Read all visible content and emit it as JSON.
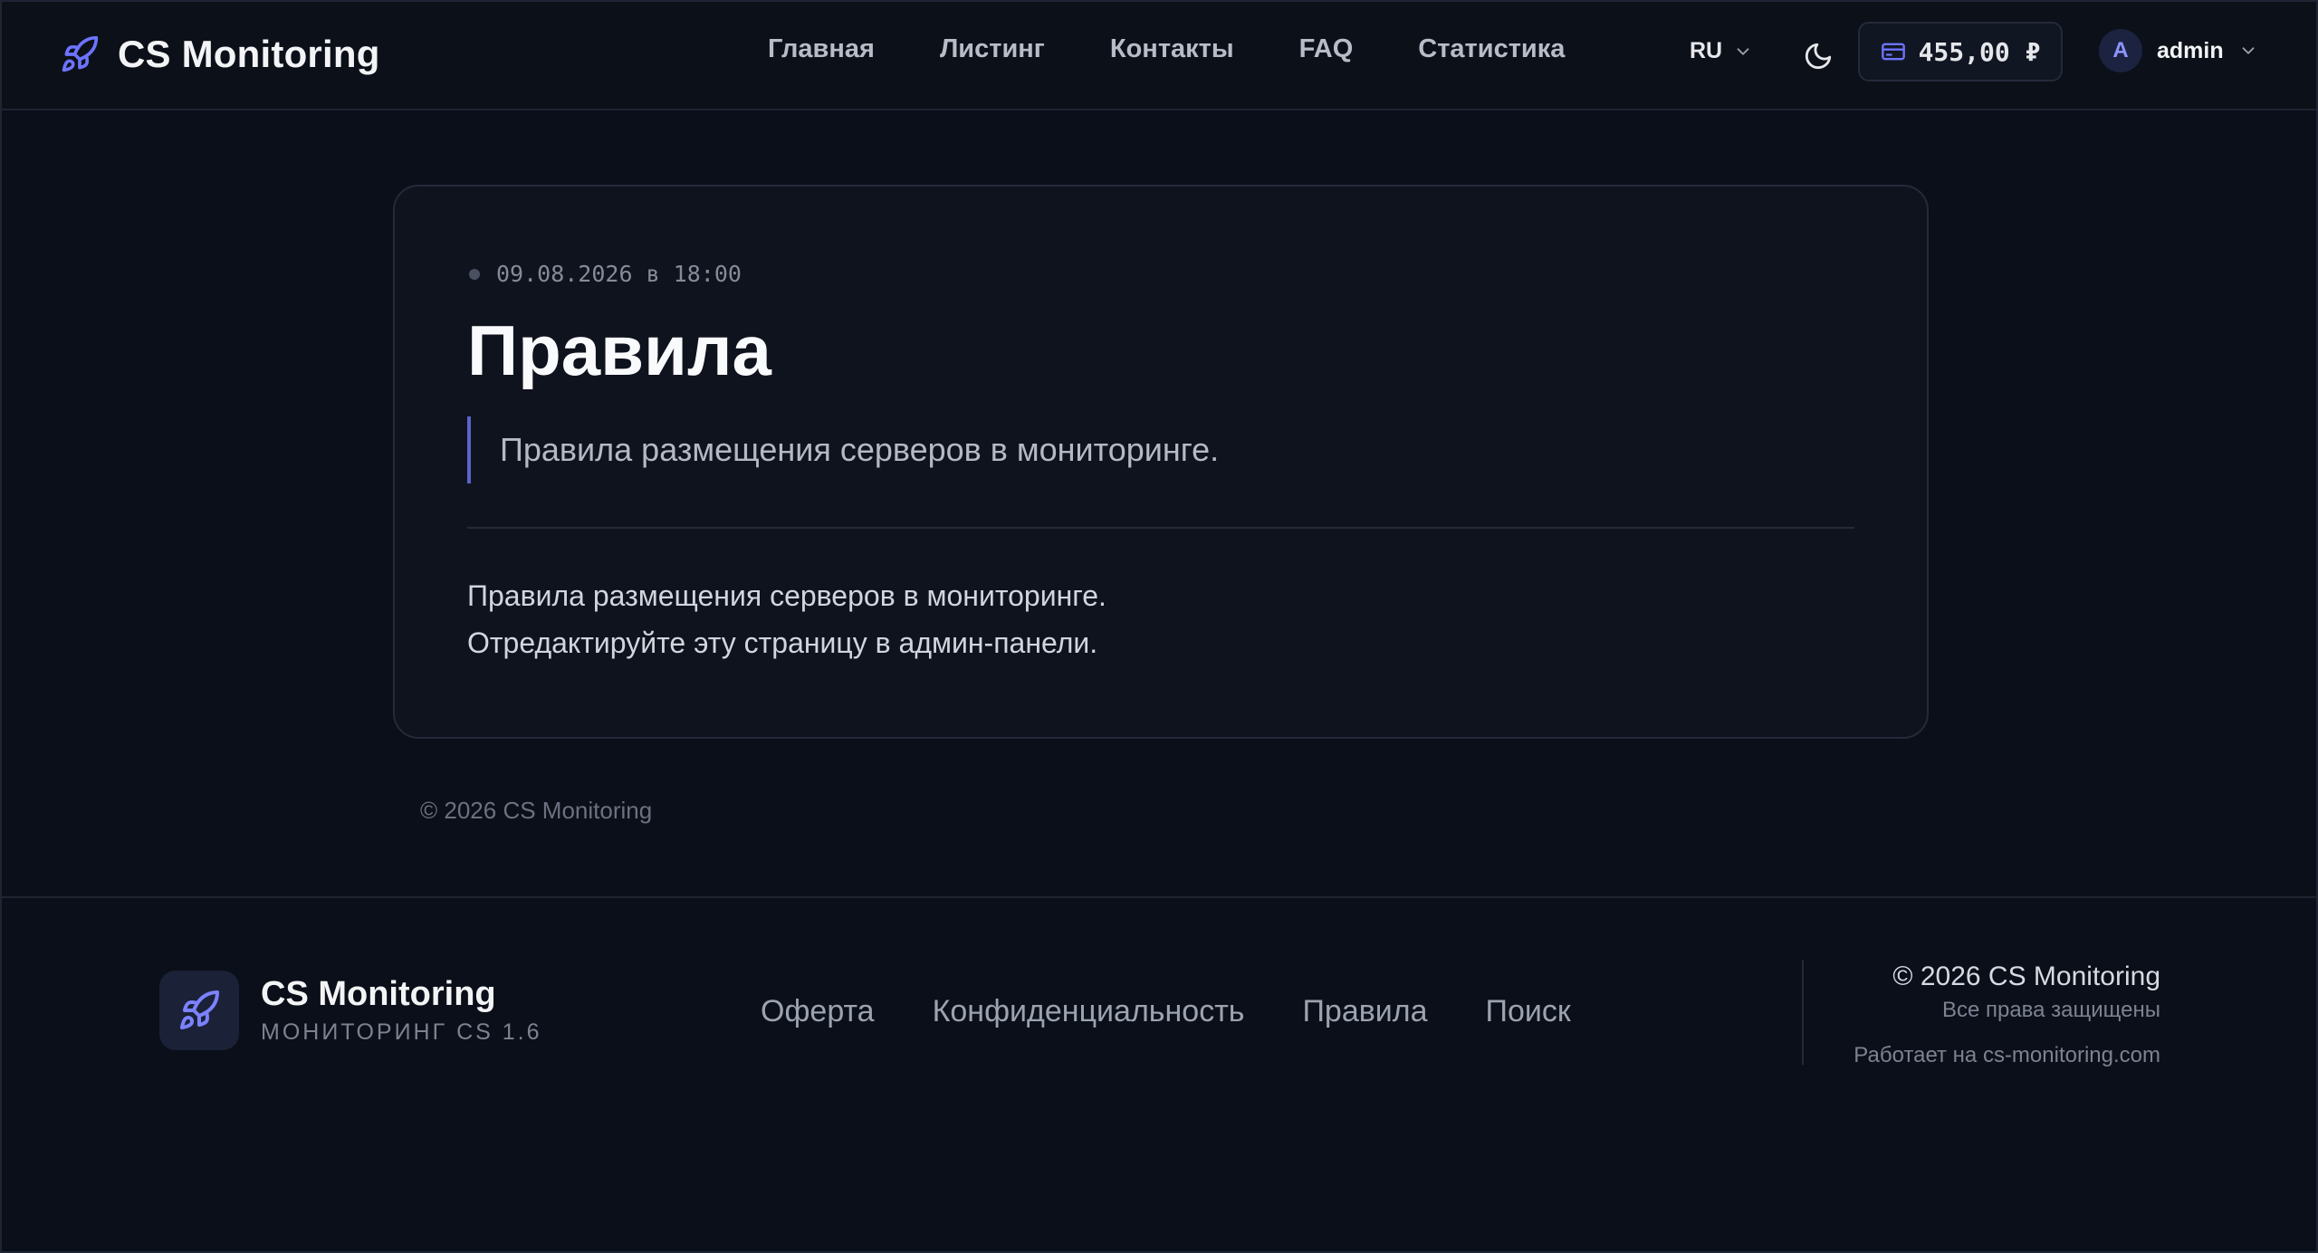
{
  "header": {
    "brand": "CS Monitoring",
    "nav": [
      "Главная",
      "Листинг",
      "Контакты",
      "FAQ",
      "Статистика"
    ],
    "language": "RU",
    "balance": "455,00 ₽",
    "user": {
      "avatar_letter": "A",
      "name": "admin"
    }
  },
  "page": {
    "date": "09.08.2026 в 18:00",
    "title": "Правила",
    "lead": "Правила размещения серверов в мониторинге.",
    "body_lines": [
      "Правила размещения серверов в мониторинге.",
      "Отредактируйте эту страницу в админ-панели."
    ],
    "copyright": "© 2026 CS Monitoring"
  },
  "footer": {
    "brand": "CS Monitoring",
    "subtitle": "МОНИТОРИНГ CS 1.6",
    "links": [
      "Оферта",
      "Конфиденциальность",
      "Правила",
      "Поиск"
    ],
    "copyright": "© 2026 CS Monitoring",
    "rights": "Все права защищены",
    "powered": "Работает на cs-monitoring.com"
  },
  "colors": {
    "accent": "#6d74ff",
    "background": "#0b0f19",
    "card": "#0f131e"
  },
  "icons": [
    "rocket-icon",
    "chevron-down-icon",
    "moon-icon",
    "wallet-icon"
  ]
}
